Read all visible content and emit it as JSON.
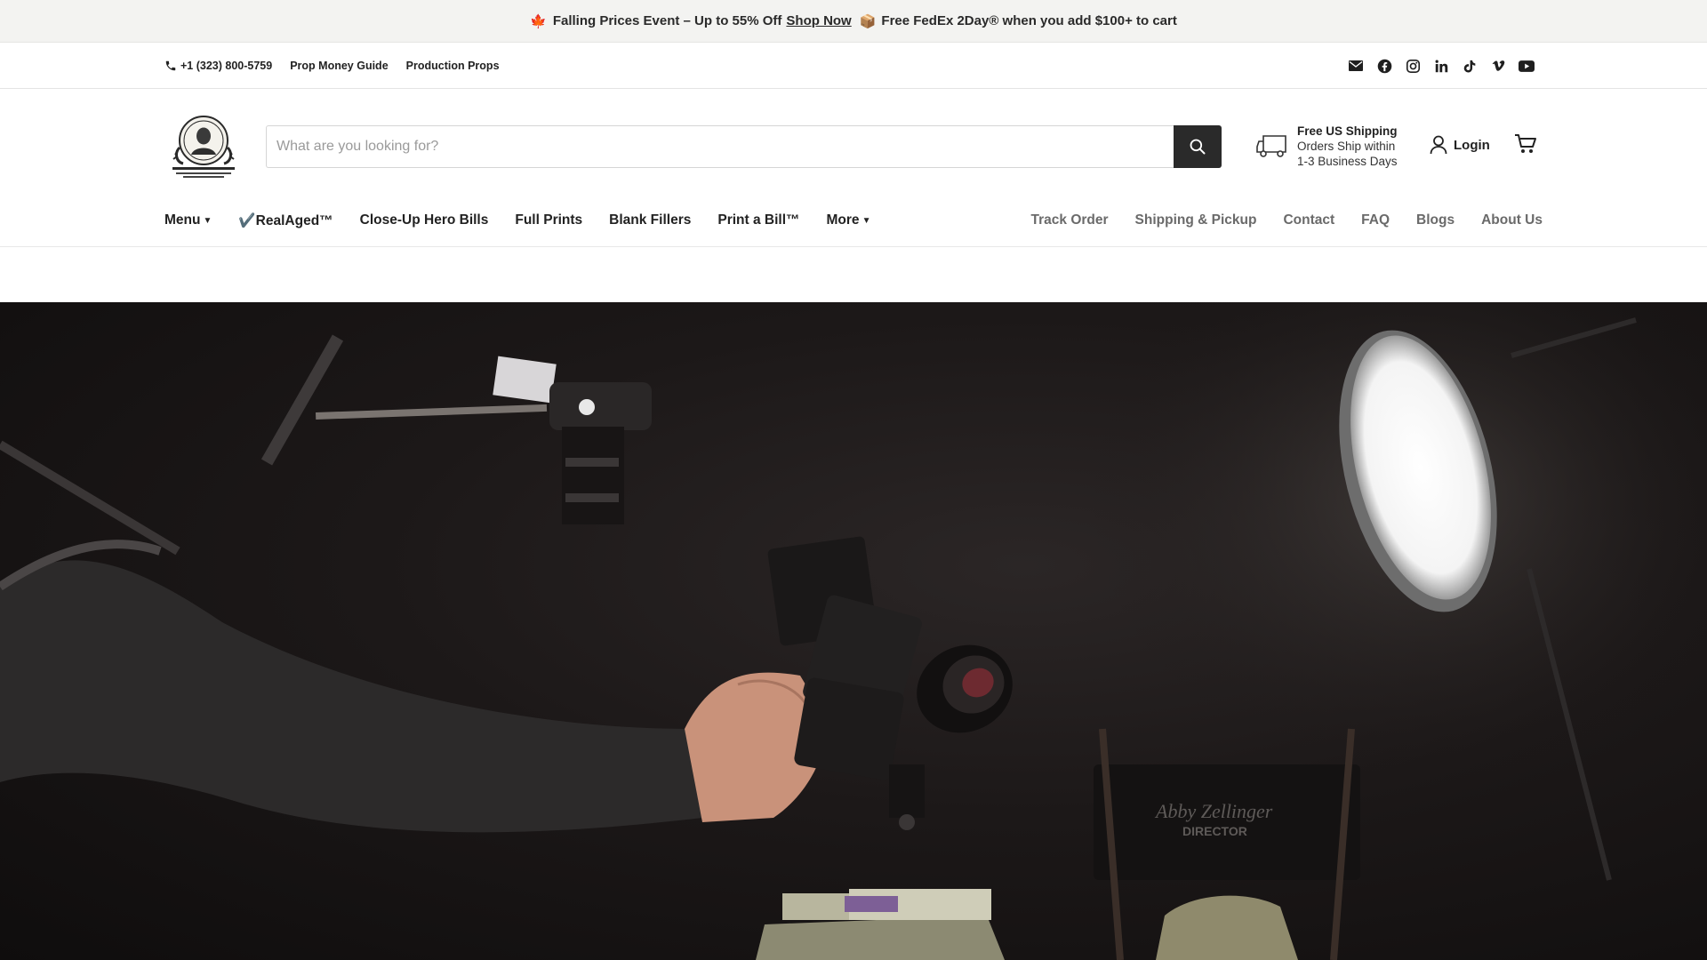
{
  "announcement": {
    "leaf_icon": "maple-leaf-icon",
    "prefix": "Falling Prices Event – Up to 55% Off",
    "link": "Shop Now",
    "box_icon": "package-icon",
    "suffix": "Free FedEx 2Day® when you add $100+ to cart",
    "leaf_color": "#c4331b"
  },
  "utility": {
    "phone": "+1 (323) 800-5759",
    "links": [
      "Prop Money Guide",
      "Production Props"
    ],
    "social_icons": [
      "email-icon",
      "facebook-icon",
      "instagram-icon",
      "linkedin-icon",
      "tiktok-icon",
      "vimeo-icon",
      "youtube-icon"
    ]
  },
  "header": {
    "logo_alt": "Prop Money Inc logo",
    "search_placeholder": "What are you looking for?",
    "shipping": {
      "title": "Free US Shipping",
      "line2": "Orders Ship within",
      "line3": "1-3 Business Days"
    },
    "login": "Login",
    "cart_icon": "cart-icon"
  },
  "nav": {
    "left": [
      {
        "label": "Menu",
        "dropdown": true
      },
      {
        "label": "✔️RealAged™",
        "dropdown": false
      },
      {
        "label": "Close-Up Hero Bills",
        "dropdown": false
      },
      {
        "label": "Full Prints",
        "dropdown": false
      },
      {
        "label": "Blank Fillers",
        "dropdown": false
      },
      {
        "label": "Print a Bill™",
        "dropdown": false
      },
      {
        "label": "More",
        "dropdown": true
      }
    ],
    "right": [
      "Track Order",
      "Shipping & Pickup",
      "Contact",
      "FAQ",
      "Blogs",
      "About Us"
    ]
  },
  "hero": {
    "chair_text_1": "Abby Zellinger",
    "chair_text_2": "DIRECTOR"
  },
  "colors": {
    "announce_bg": "#f3f3f1",
    "search_button": "#2a2a2a",
    "hero_bg": "#1c1818"
  }
}
